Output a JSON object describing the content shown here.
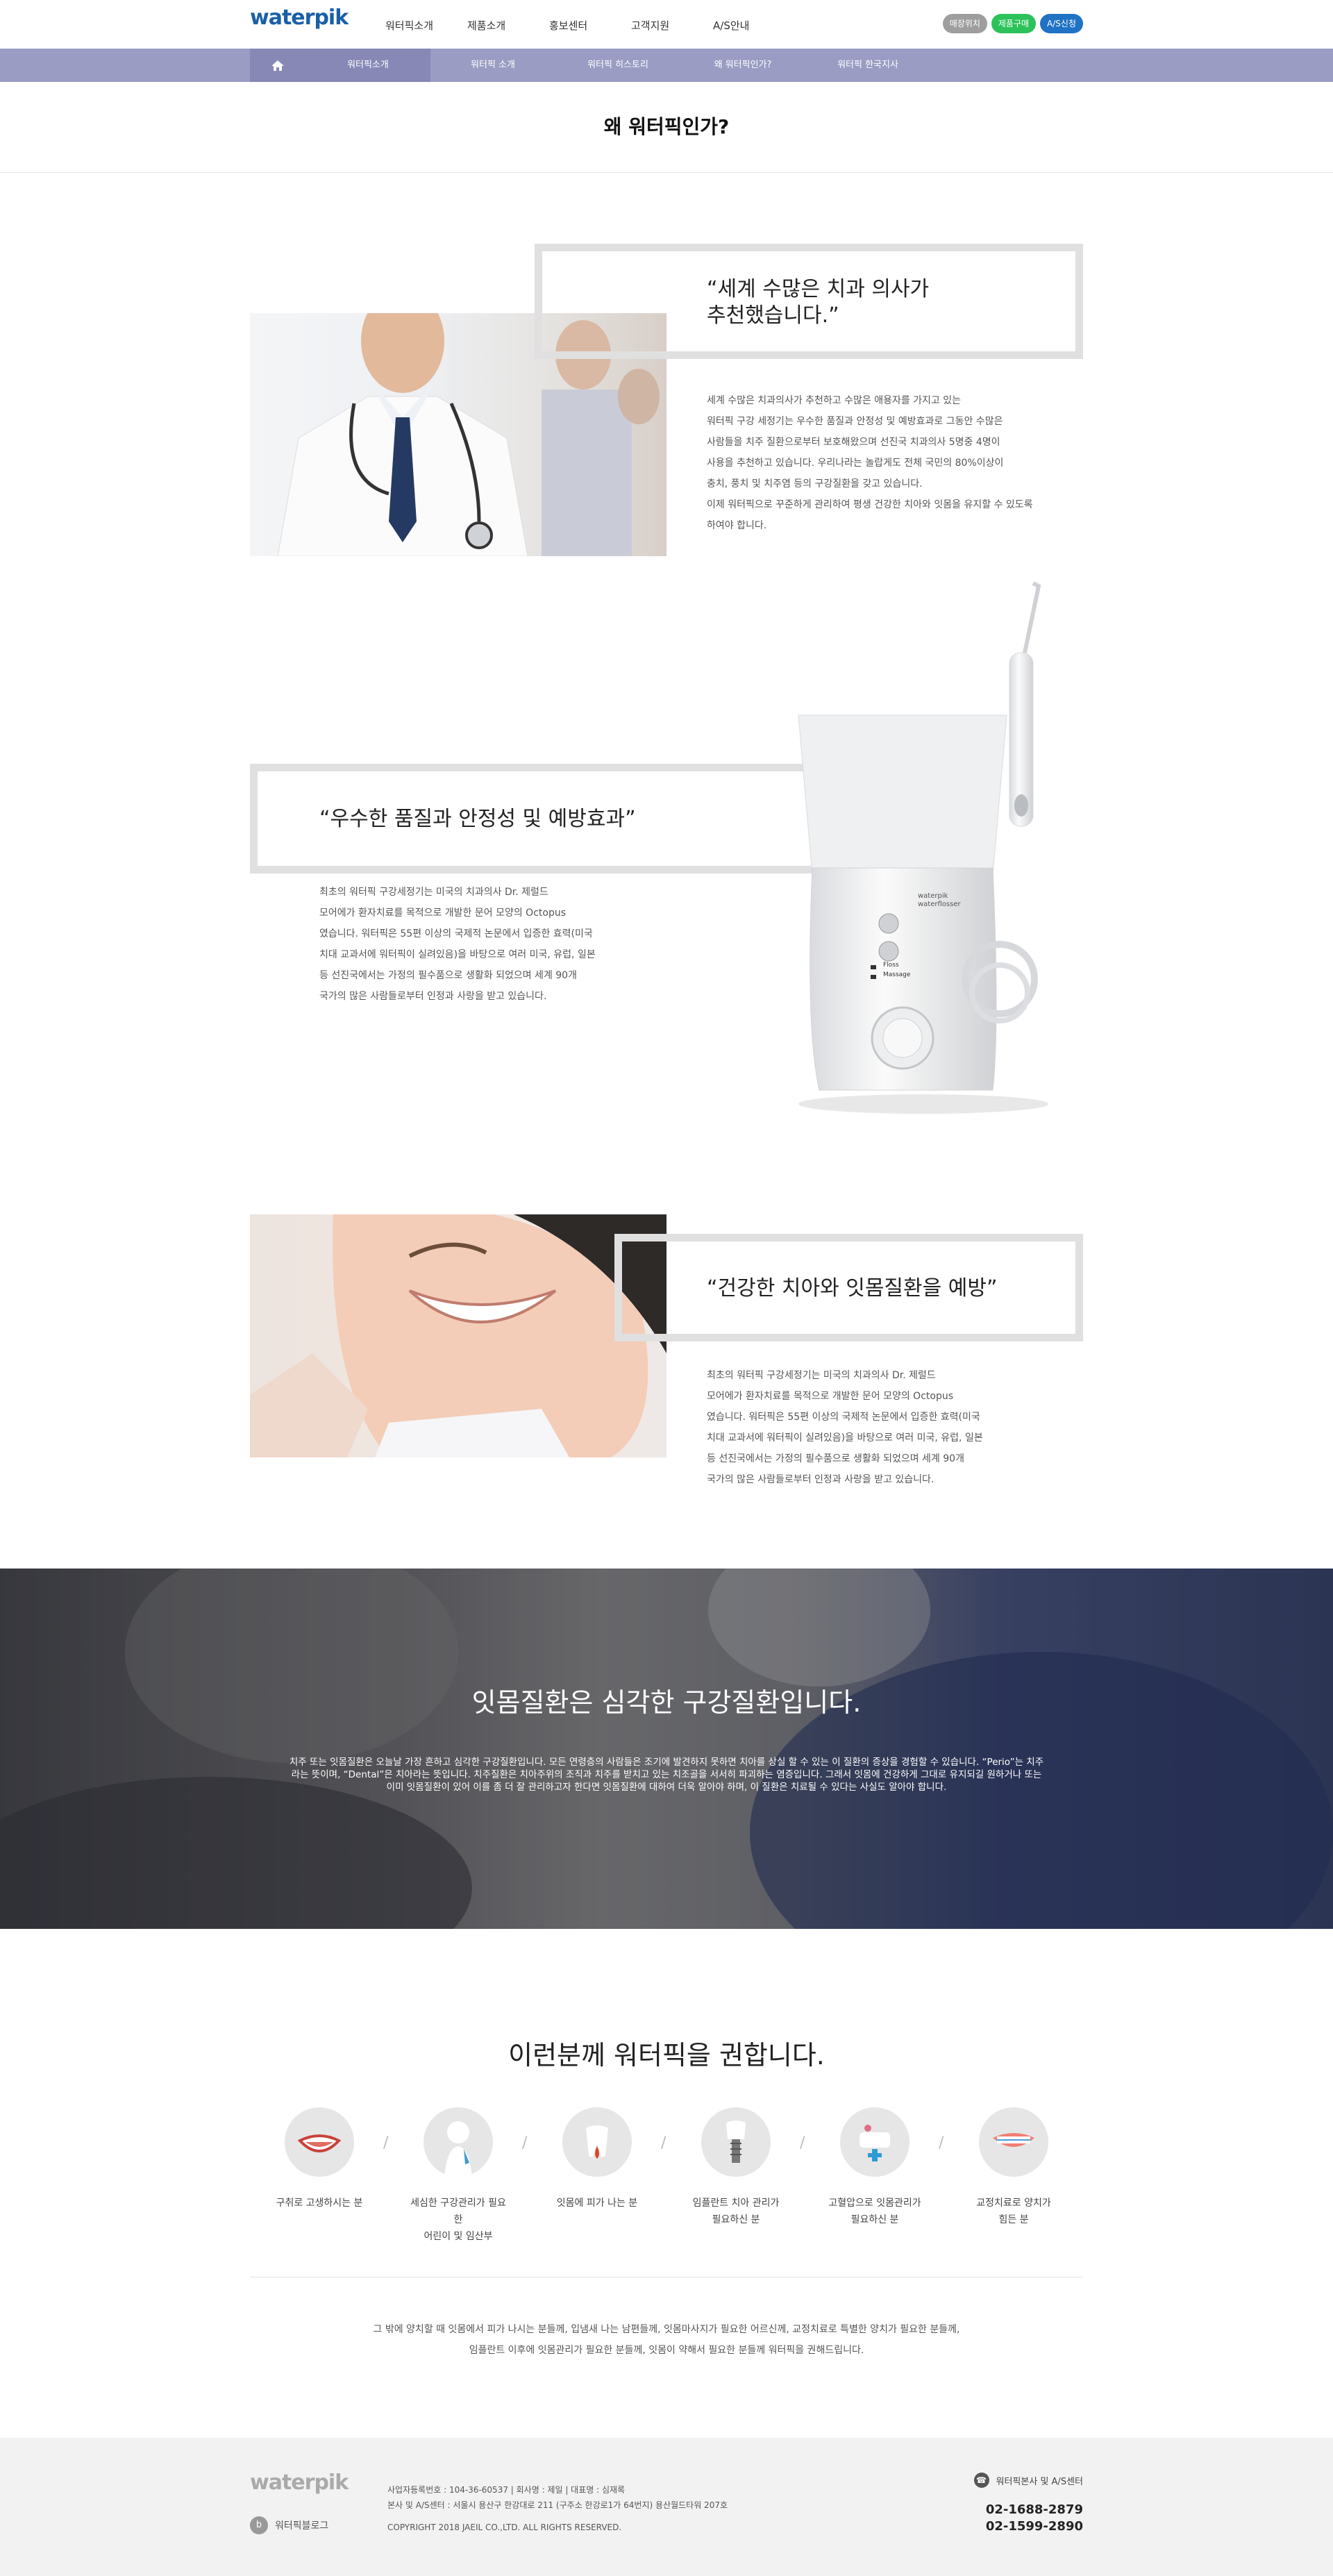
{
  "header": {
    "logo": "waterpik",
    "nav": [
      "워터픽소개",
      "제품소개",
      "홍보센터",
      "고객지원",
      "A/S안내"
    ],
    "buttons": {
      "shop": {
        "label": "매장위치",
        "color": "#9e9e9e"
      },
      "buy": {
        "label": "제품구매",
        "color": "#2cc25a"
      },
      "as": {
        "label": "A/S신청",
        "color": "#1f72c4"
      }
    }
  },
  "subnav": {
    "items": [
      "워터픽소개",
      "워터픽 소개",
      "워터픽 히스토리",
      "왜 워터픽인가?",
      "워터픽 한국지사"
    ]
  },
  "page_title": "왜 워터픽인가?",
  "section1": {
    "quote": "“세계 수많은 치과 의사가\n추천했습니다.”",
    "text": "세계 수많은 치과의사가 추천하고 수많은 애용자를 가지고 있는\n워터픽 구강 세정기는 우수한 품질과 안정성 및 예방효과로 그동안 수많은\n사람들을 치주 질환으로부터 보호해왔으며 선진국 치과의사 5명중 4명이\n사용을 추천하고 있습니다. 우리나라는 놀랍게도 전체 국민의 80%이상이\n충치, 풍치 및 치주염 등의 구강질환을 갖고 있습니다.\n이제 워터픽으로 꾸준하게 관리하여 평생 건강한 치아와 잇몸을 유지할 수 있도록\n하여야 합니다."
  },
  "section2": {
    "quote": "“우수한 품질과 안정성 및 예방효과”",
    "text": "최초의 워터픽 구강세정기는 미국의 치과의사 Dr. 제럴드\n모어에가 환자치료를 목적으로 개발한 문어 모양의 Octopus\n였습니다. 워터픽은 55편 이상의 국제적 논문에서 입증한 효력(미국\n치대 교과서에 워터픽이 실려있음)을 바탕으로 여러 미국, 유럽, 일본\n등 선진국에서는 가정의 필수품으로 생활화 되었으며 세계 90개\n국가의 많은 사람들로부터 인정과 사랑을 받고 있습니다.",
    "product_brand": "waterpik\nwaterflosser",
    "product_labels": [
      "Floss",
      "Massage"
    ]
  },
  "section3": {
    "quote": "“건강한 치아와 잇몸질환을 예방”",
    "text": "최초의 워터픽 구강세정기는 미국의 치과의사 Dr. 제럴드\n모어에가 환자치료를 목적으로 개발한 문어 모양의 Octopus\n였습니다. 워터픽은 55편 이상의 국제적 논문에서 입증한 효력(미국\n치대 교과서에 워터픽이 실려있음)을 바탕으로 여러 미국, 유럽, 일본\n등 선진국에서는 가정의 필수품으로 생활화 되었으며 세계 90개\n국가의 많은 사람들로부터 인정과 사랑을 받고 있습니다."
  },
  "banner": {
    "title": "잇몸질환은 심각한 구강질환입니다.",
    "text": "치주 또는 잇몸질환은 오늘날 가장 흔하고 심각한 구강질환입니다. 모든 연령층의 사람들은 조기에 발견하지 못하면 치아를 상실 할 수 있는 이 질환의 증상을 경험할 수 있습니다. “Perio”는 치주라는 뜻이며, “Dental”은 치아라는 뜻입니다. 치주질환은 치아주위의 조직과 치주를 받치고 있는 치조골을 서서히 파괴하는 염증입니다. 그래서 잇몸에 건강하게 그대로 유지되길 원하거나 또는 이미 잇몸질환이 있어 이를 좀 더 잘 관리하고자 한다면 잇몸질환에 대하여 더욱 알아야 하며, 이 질환은 치료될 수 있다는 사실도 알아야 합니다."
  },
  "recommend": {
    "title": "이런분께 워터픽을 권합니다.",
    "items": [
      {
        "label": "구취로 고생하시는 분",
        "icon": "mouth-icon"
      },
      {
        "label": "세심한 구강관리가 필요한\n어린이 및 임산부",
        "icon": "child-icon"
      },
      {
        "label": "잇몸에 피가 나는 분",
        "icon": "bleeding-gum-icon"
      },
      {
        "label": "임플란트 치아 관리가\n필요하신 분",
        "icon": "implant-icon"
      },
      {
        "label": "고혈압으로 잇몸관리가\n필요하신 분",
        "icon": "blood-pressure-icon"
      },
      {
        "label": "교정치료로 양치가\n힘든 분",
        "icon": "braces-icon"
      }
    ],
    "note": "그 밖에 양치할 때 잇몸에서 피가 나시는 분들께, 입냄새 나는 남편들께, 잇몸마사지가 필요한 어르신께, 교정치료로 특별한 양치가 필요한 분들께,\n임플란트 이후에 잇몸관리가 필요한 분들께, 잇몸이 약해서 필요한 분들께 워터픽을 권해드립니다."
  },
  "footer": {
    "logo": "waterpik",
    "blog": "워터픽블로그",
    "blog_badge": "b",
    "info": [
      "사업자등록번호 : 104-36-60537  |  회사명 : 제일  |  대표명 : 심재록",
      "본사 및 A/S센터 : 서울시 용산구 한강대로 211 (구주소 한강로1가 64번지) 용산월드타워 207호",
      "COPYRIGHT 2018 JAEIL CO.,LTD. ALL RIGHTS RESERVED."
    ],
    "cs_title": "워터픽본사 및 A/S센터",
    "tels": [
      "02-1688-2879",
      "02-1599-2890"
    ]
  }
}
